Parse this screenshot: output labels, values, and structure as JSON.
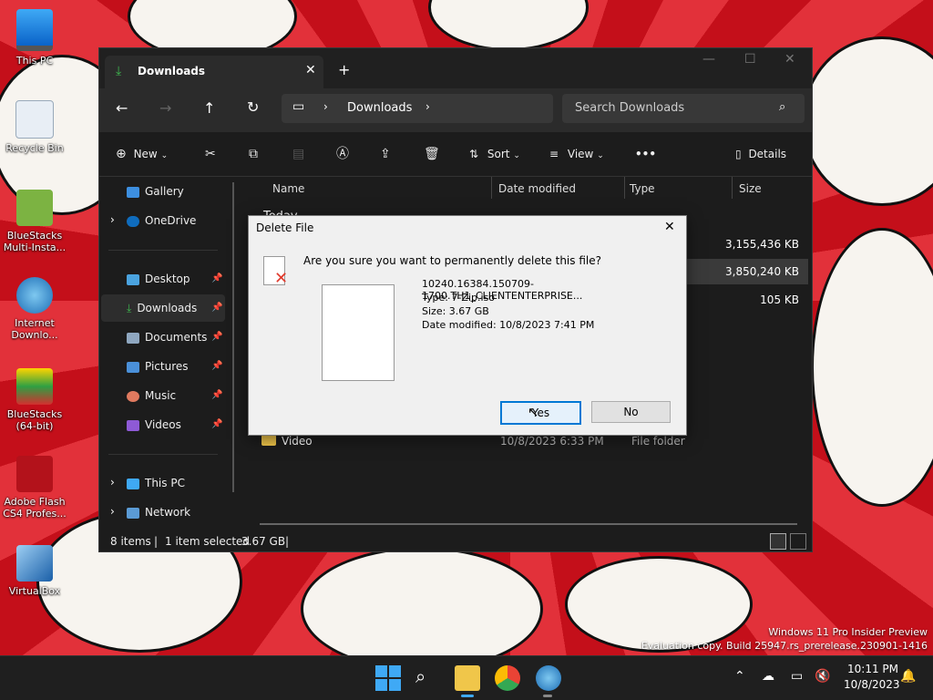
{
  "desktop": {
    "icons": [
      {
        "label": "This PC"
      },
      {
        "label": "Recycle Bin"
      },
      {
        "label": "BlueStacks Multi-Insta..."
      },
      {
        "label": "Internet Downlo..."
      },
      {
        "label": "BlueStacks (64-bit)"
      },
      {
        "label": "Adobe Flash CS4 Profes..."
      },
      {
        "label": "VirtualBox"
      }
    ],
    "watermark_line1": "Windows 11 Pro Insider Preview",
    "watermark_line2": "Evaluation copy. Build 25947.rs_prerelease.230901-1416"
  },
  "explorer": {
    "tab_title": "Downloads",
    "new_tab_glyph": "+",
    "address": {
      "location": "Downloads"
    },
    "search": {
      "placeholder": "Search Downloads"
    },
    "toolbar": {
      "new_label": "New",
      "sort_label": "Sort",
      "view_label": "View",
      "more_glyph": "•••",
      "details_label": "Details"
    },
    "sidebar": {
      "items": [
        {
          "label": "Gallery"
        },
        {
          "label": "OneDrive"
        },
        {
          "label": "Desktop"
        },
        {
          "label": "Downloads"
        },
        {
          "label": "Documents"
        },
        {
          "label": "Pictures"
        },
        {
          "label": "Music"
        },
        {
          "label": "Videos"
        },
        {
          "label": "This PC"
        },
        {
          "label": "Network"
        }
      ]
    },
    "columns": {
      "name": "Name",
      "date": "Date modified",
      "type": "Type",
      "size": "Size"
    },
    "group_header": "Today",
    "sizes": [
      "3,155,436 KB",
      "3,850,240 KB",
      "105 KB"
    ],
    "rows": [
      {
        "name": "Video",
        "date": "10/8/2023 6:33 PM",
        "type": "File folder"
      }
    ],
    "status": {
      "items": "8 items",
      "selected": "1 item selected",
      "size": "3.67 GB"
    }
  },
  "dialog": {
    "title": "Delete File",
    "question": "Are you sure you want to permanently delete this file?",
    "file_name": "10240.16384.150709-1700.TH1_CLIENTENTERPRISE...",
    "file_type": "Type: 7-Zip.iso",
    "file_size": "Size: 3.67 GB",
    "file_date": "Date modified: 10/8/2023 7:41 PM",
    "yes_label": "Yes",
    "no_label": "No"
  },
  "taskbar": {
    "time": "10:11 PM",
    "date": "10/8/2023"
  },
  "colors": {
    "accent": "#0078d4",
    "delete_x": "#e0392b"
  }
}
